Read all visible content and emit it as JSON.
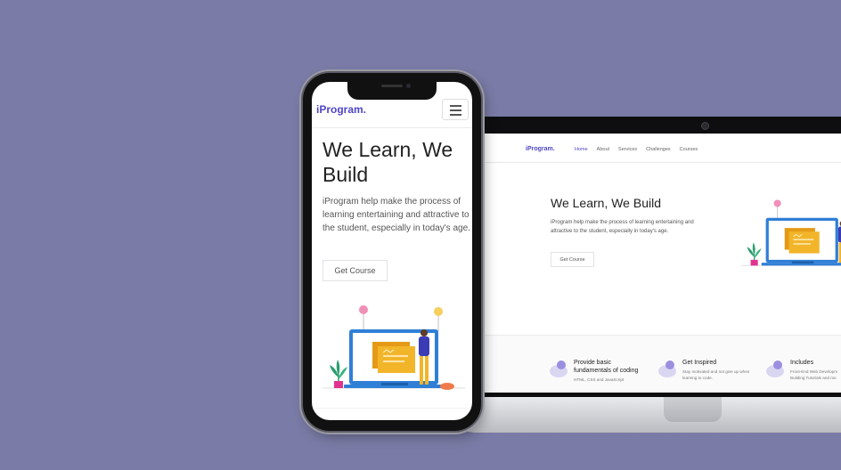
{
  "brand": "iProgram.",
  "nav": {
    "links": [
      {
        "label": "Home",
        "active": true
      },
      {
        "label": "About",
        "active": false
      },
      {
        "label": "Services",
        "active": false
      },
      {
        "label": "Challenges",
        "active": false
      },
      {
        "label": "Courses",
        "active": false
      }
    ]
  },
  "hero": {
    "title": "We Learn, We Build",
    "description": "iProgram help make the process of learning entertaining and attractive to the student, especially in today's age.",
    "button_label": "Get Course"
  },
  "features": [
    {
      "title_line1": "Provide basic",
      "title_line2": "fundamentals of coding",
      "desc_line1": "HTML, CSS and JavaScript",
      "desc_line2": ""
    },
    {
      "title_line1": "Get Inspired",
      "title_line2": "",
      "desc_line1": "Stay motivated and not give up when",
      "desc_line2": "learning to code."
    },
    {
      "title_line1": "Includes",
      "title_line2": "",
      "desc_line1": "Front-End Web Developm",
      "desc_line2": "Building Tutorials and mo"
    }
  ],
  "colors": {
    "background": "#7a7ba6",
    "brand": "#4f46c4",
    "illustration_laptop": "#2f7fd6",
    "illustration_cards": "#f2b52a",
    "feature_icon": "#9b8fe0"
  },
  "icons": {
    "menu": "hamburger-icon",
    "feature": "blob-icon"
  }
}
